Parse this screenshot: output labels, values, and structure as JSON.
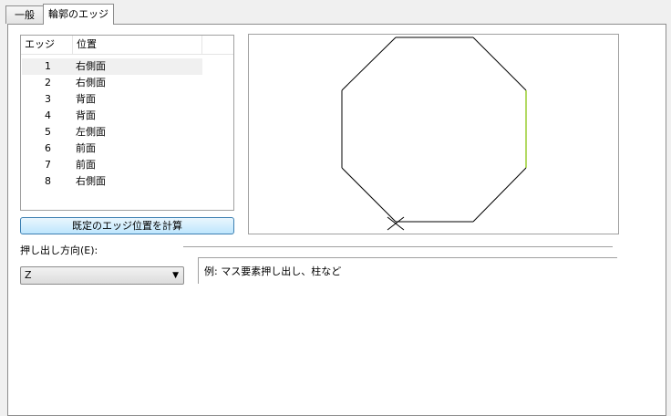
{
  "tabs": [
    {
      "label": "一般"
    },
    {
      "label": "輪郭のエッジ"
    }
  ],
  "edge_list": {
    "columns": [
      "エッジ",
      "位置"
    ],
    "rows": [
      {
        "num": "1",
        "pos": "右側面"
      },
      {
        "num": "2",
        "pos": "右側面"
      },
      {
        "num": "3",
        "pos": "背面"
      },
      {
        "num": "4",
        "pos": "背面"
      },
      {
        "num": "5",
        "pos": "左側面"
      },
      {
        "num": "6",
        "pos": "前面"
      },
      {
        "num": "7",
        "pos": "前面"
      },
      {
        "num": "8",
        "pos": "右側面"
      }
    ],
    "selected_index": 0
  },
  "calc_button": "既定のエッジ位置を計算",
  "extrude": {
    "label": "押し出し方向(E):",
    "value": "Z"
  },
  "hint_text": "例: マス要素押し出し、柱など",
  "preview": {
    "edge_color": "#000000",
    "highlight_color": "#9acd32"
  }
}
